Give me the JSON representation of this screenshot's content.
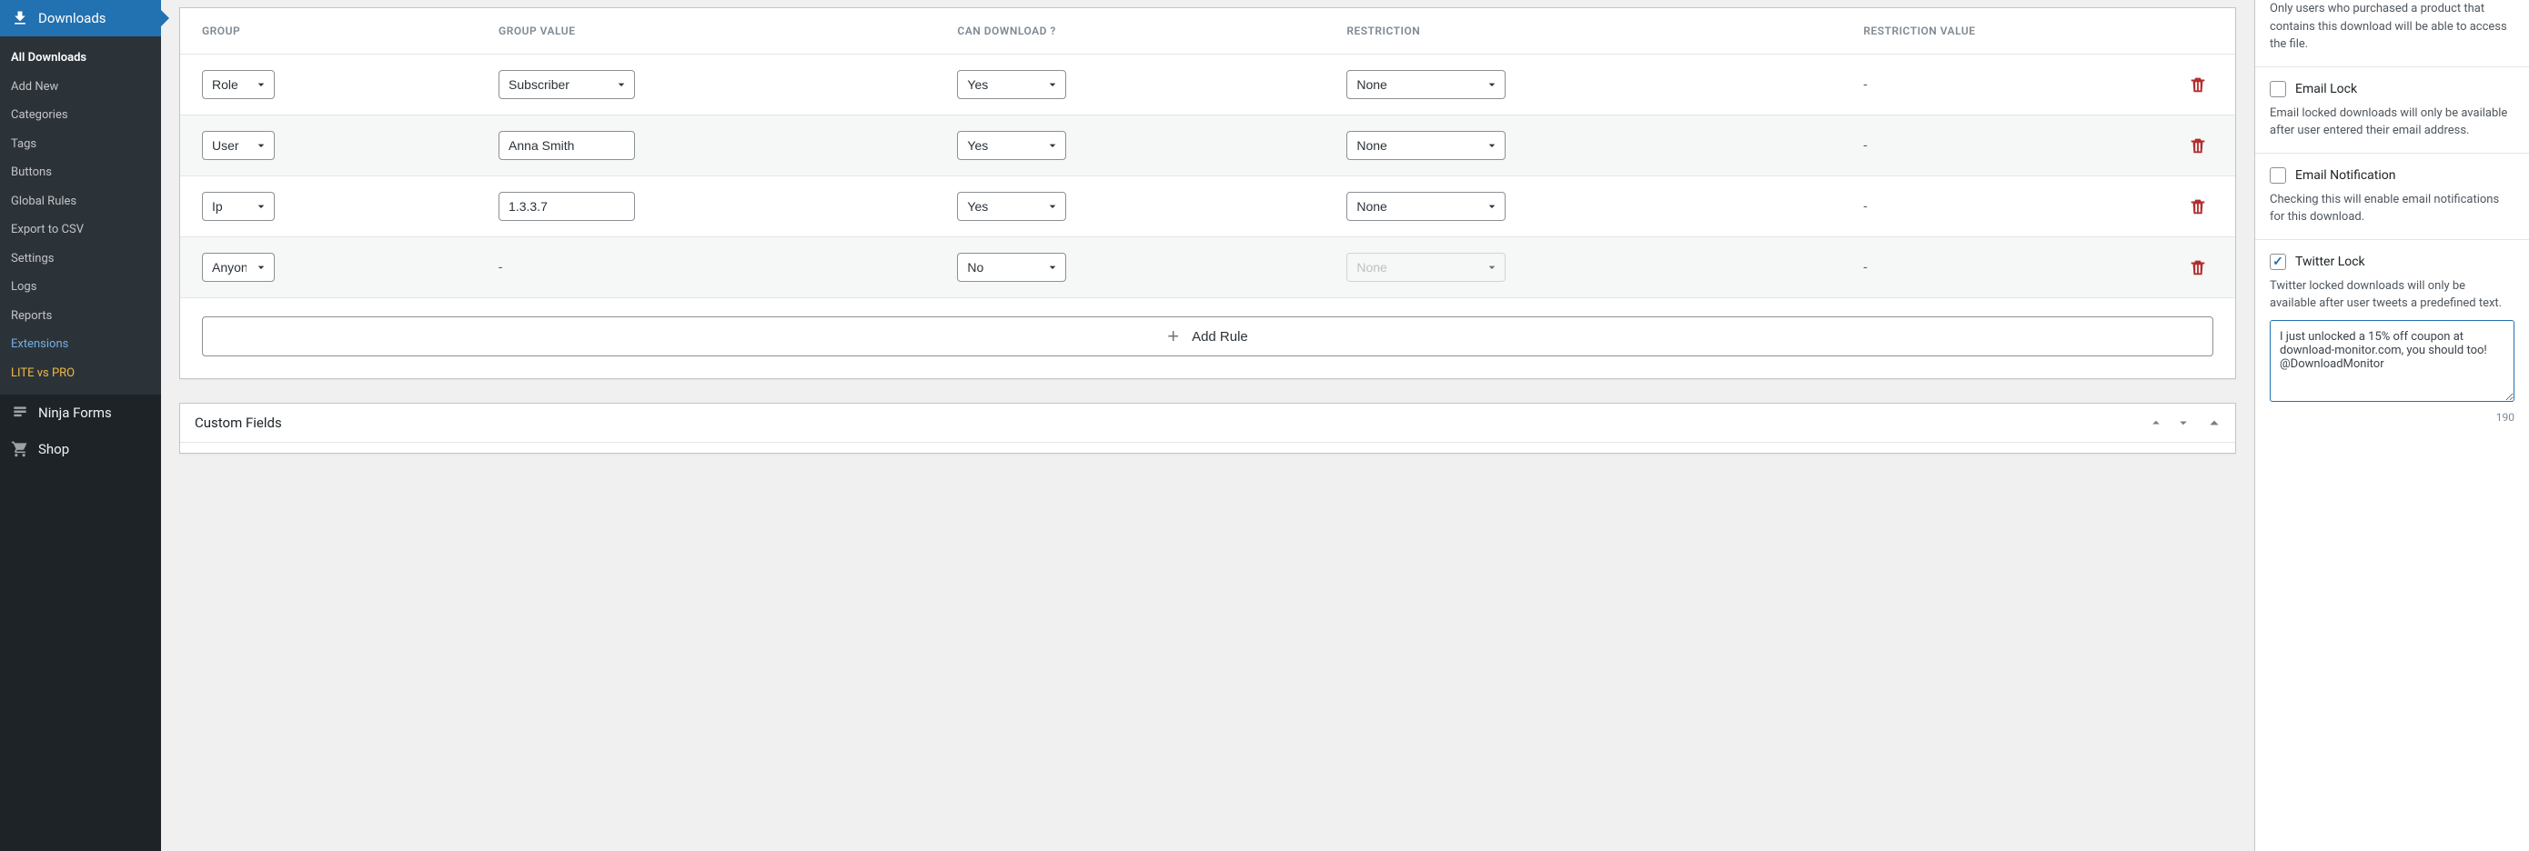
{
  "sidebar": {
    "main_label": "Downloads",
    "items": [
      {
        "label": "All Downloads",
        "current": true
      },
      {
        "label": "Add New"
      },
      {
        "label": "Categories"
      },
      {
        "label": "Tags"
      },
      {
        "label": "Buttons"
      },
      {
        "label": "Global Rules"
      },
      {
        "label": "Export to CSV"
      },
      {
        "label": "Settings"
      },
      {
        "label": "Logs"
      },
      {
        "label": "Reports"
      },
      {
        "label": "Extensions",
        "highlight": true
      },
      {
        "label": "LITE vs PRO",
        "upgrade": true
      }
    ],
    "other": [
      {
        "label": "Ninja Forms",
        "icon": "form"
      },
      {
        "label": "Shop",
        "icon": "cart"
      }
    ]
  },
  "rules_table": {
    "headers": {
      "group": "GROUP",
      "group_value": "GROUP VALUE",
      "can_download": "CAN DOWNLOAD ?",
      "restriction": "RESTRICTION",
      "restriction_value": "RESTRICTION VALUE"
    },
    "rows": [
      {
        "group": "Role",
        "group_value_type": "select",
        "group_value": "Subscriber",
        "can_download": "Yes",
        "restriction": "None",
        "restriction_value": "-"
      },
      {
        "group": "User",
        "group_value_type": "input",
        "group_value": "Anna Smith",
        "can_download": "Yes",
        "restriction": "None",
        "restriction_value": "-"
      },
      {
        "group": "Ip",
        "group_value_type": "input",
        "group_value": "1.3.3.7",
        "can_download": "Yes",
        "restriction": "None",
        "restriction_value": "-"
      },
      {
        "group": "Anyone",
        "group_value_type": "dash",
        "group_value": "-",
        "can_download": "No",
        "restriction": "None",
        "restriction_disabled": true,
        "restriction_value": "-"
      }
    ],
    "add_rule_label": "Add Rule"
  },
  "custom_fields": {
    "title": "Custom Fields"
  },
  "meta": {
    "purchase_desc": "Only users who purchased a product that contains this download will be able to access the file.",
    "email_lock": {
      "label": "Email Lock",
      "desc": "Email locked downloads will only be available after user entered their email address."
    },
    "email_notification": {
      "label": "Email Notification",
      "desc": "Checking this will enable email notifications for this download."
    },
    "twitter_lock": {
      "label": "Twitter Lock",
      "desc": "Twitter locked downloads will only be available after user tweets a predefined text.",
      "checked": true
    },
    "tweet_text": "I just unlocked a 15% off coupon at download-monitor.com, you should too! @DownloadMonitor",
    "char_count": "190"
  }
}
